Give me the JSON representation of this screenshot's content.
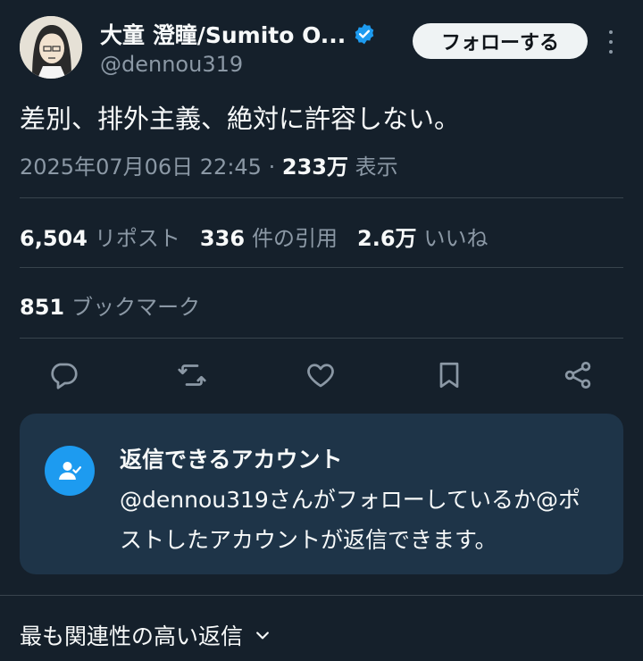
{
  "author": {
    "display_name": "大童 澄瞳/Sumito O...",
    "handle": "@dennou319",
    "verified_icon": "verified-badge-icon"
  },
  "follow_button_label": "フォローする",
  "tweet": {
    "text": "差別、排外主義、絶対に許容しない。",
    "timestamp": "2025年07月06日 22:45",
    "separator": "·",
    "views_count": "233万",
    "views_label": "表示"
  },
  "stats": {
    "reposts_count": "6,504",
    "reposts_label": "リポスト",
    "quotes_count": "336",
    "quotes_label": "件の引用",
    "likes_count": "2.6万",
    "likes_label": "いいね",
    "bookmarks_count": "851",
    "bookmarks_label": "ブックマーク"
  },
  "action_icons": [
    "reply-icon",
    "repost-icon",
    "like-icon",
    "bookmark-icon",
    "share-icon"
  ],
  "reply_restriction": {
    "title": "返信できるアカウント",
    "description": "@dennou319さんがフォローしているか@ポストしたアカウントが返信できます。"
  },
  "sort": {
    "label": "最も関連性の高い返信"
  },
  "colors": {
    "background": "#15202b",
    "accent": "#1d9bf0",
    "muted_text": "#8b98a5",
    "card_bg": "#1e3448"
  }
}
